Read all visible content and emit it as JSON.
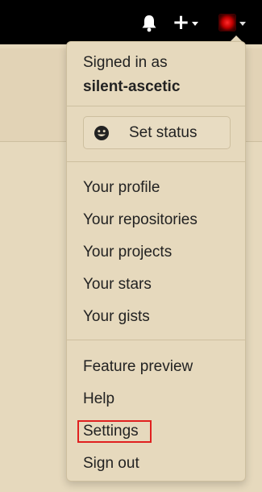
{
  "header": {
    "notifications_icon": "bell-icon",
    "create_icon": "plus-icon",
    "avatar_icon": "avatar"
  },
  "menu": {
    "signed_in_label": "Signed in as",
    "username": "silent-ascetic",
    "set_status_label": "Set status",
    "group1": [
      "Your profile",
      "Your repositories",
      "Your projects",
      "Your stars",
      "Your gists"
    ],
    "group2": [
      "Feature preview",
      "Help",
      "Settings",
      "Sign out"
    ]
  },
  "colors": {
    "topbar": "#000000",
    "menu_background": "#e6d9bd",
    "highlight_border": "#e0201f"
  }
}
